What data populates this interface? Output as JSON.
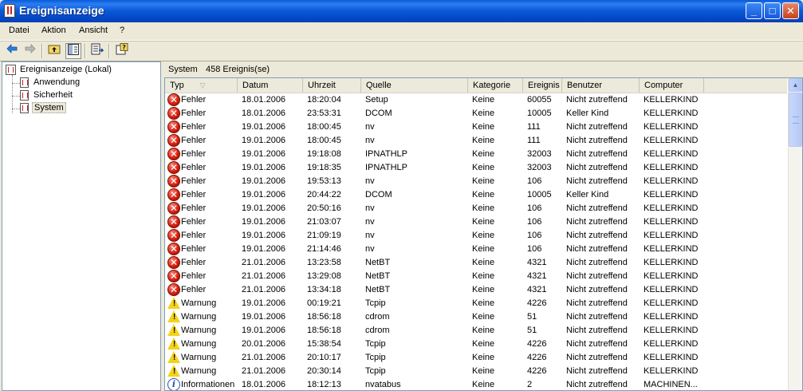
{
  "window": {
    "title": "Ereignisanzeige",
    "buttons": {
      "minimize": "_",
      "maximize": "□",
      "close": "✕"
    }
  },
  "menu": [
    {
      "label": "Datei"
    },
    {
      "label": "Aktion"
    },
    {
      "label": "Ansicht"
    },
    {
      "label": "?"
    }
  ],
  "toolbar": {
    "icons": [
      "back-arrow-icon",
      "forward-arrow-icon",
      "up-folder-icon",
      "show-hide-tree-icon",
      "export-list-icon",
      "help-icon"
    ],
    "active": "show-hide-tree-icon"
  },
  "tree": {
    "root": "Ereignisanzeige (Lokal)",
    "children": [
      {
        "label": "Anwendung"
      },
      {
        "label": "Sicherheit"
      },
      {
        "label": "System"
      }
    ],
    "selected": "System"
  },
  "status": {
    "log": "System",
    "count": "458 Ereignis(se)"
  },
  "columns": [
    "Typ",
    "Datum",
    "Uhrzeit",
    "Quelle",
    "Kategorie",
    "Ereignis",
    "Benutzer",
    "Computer"
  ],
  "events": [
    {
      "type": "error",
      "typ": "Fehler",
      "datum": "18.01.2006",
      "uhrzeit": "18:20:04",
      "quelle": "Setup",
      "kategorie": "Keine",
      "ereignis": "60055",
      "benutzer": "Nicht zutreffend",
      "computer": "KELLERKIND"
    },
    {
      "type": "error",
      "typ": "Fehler",
      "datum": "18.01.2006",
      "uhrzeit": "23:53:31",
      "quelle": "DCOM",
      "kategorie": "Keine",
      "ereignis": "10005",
      "benutzer": "Keller Kind",
      "computer": "KELLERKIND"
    },
    {
      "type": "error",
      "typ": "Fehler",
      "datum": "19.01.2006",
      "uhrzeit": "18:00:45",
      "quelle": "nv",
      "kategorie": "Keine",
      "ereignis": "111",
      "benutzer": "Nicht zutreffend",
      "computer": "KELLERKIND"
    },
    {
      "type": "error",
      "typ": "Fehler",
      "datum": "19.01.2006",
      "uhrzeit": "18:00:45",
      "quelle": "nv",
      "kategorie": "Keine",
      "ereignis": "111",
      "benutzer": "Nicht zutreffend",
      "computer": "KELLERKIND"
    },
    {
      "type": "error",
      "typ": "Fehler",
      "datum": "19.01.2006",
      "uhrzeit": "19:18:08",
      "quelle": "IPNATHLP",
      "kategorie": "Keine",
      "ereignis": "32003",
      "benutzer": "Nicht zutreffend",
      "computer": "KELLERKIND"
    },
    {
      "type": "error",
      "typ": "Fehler",
      "datum": "19.01.2006",
      "uhrzeit": "19:18:35",
      "quelle": "IPNATHLP",
      "kategorie": "Keine",
      "ereignis": "32003",
      "benutzer": "Nicht zutreffend",
      "computer": "KELLERKIND"
    },
    {
      "type": "error",
      "typ": "Fehler",
      "datum": "19.01.2006",
      "uhrzeit": "19:53:13",
      "quelle": "nv",
      "kategorie": "Keine",
      "ereignis": "106",
      "benutzer": "Nicht zutreffend",
      "computer": "KELLERKIND"
    },
    {
      "type": "error",
      "typ": "Fehler",
      "datum": "19.01.2006",
      "uhrzeit": "20:44:22",
      "quelle": "DCOM",
      "kategorie": "Keine",
      "ereignis": "10005",
      "benutzer": "Keller Kind",
      "computer": "KELLERKIND"
    },
    {
      "type": "error",
      "typ": "Fehler",
      "datum": "19.01.2006",
      "uhrzeit": "20:50:16",
      "quelle": "nv",
      "kategorie": "Keine",
      "ereignis": "106",
      "benutzer": "Nicht zutreffend",
      "computer": "KELLERKIND"
    },
    {
      "type": "error",
      "typ": "Fehler",
      "datum": "19.01.2006",
      "uhrzeit": "21:03:07",
      "quelle": "nv",
      "kategorie": "Keine",
      "ereignis": "106",
      "benutzer": "Nicht zutreffend",
      "computer": "KELLERKIND"
    },
    {
      "type": "error",
      "typ": "Fehler",
      "datum": "19.01.2006",
      "uhrzeit": "21:09:19",
      "quelle": "nv",
      "kategorie": "Keine",
      "ereignis": "106",
      "benutzer": "Nicht zutreffend",
      "computer": "KELLERKIND"
    },
    {
      "type": "error",
      "typ": "Fehler",
      "datum": "19.01.2006",
      "uhrzeit": "21:14:46",
      "quelle": "nv",
      "kategorie": "Keine",
      "ereignis": "106",
      "benutzer": "Nicht zutreffend",
      "computer": "KELLERKIND"
    },
    {
      "type": "error",
      "typ": "Fehler",
      "datum": "21.01.2006",
      "uhrzeit": "13:23:58",
      "quelle": "NetBT",
      "kategorie": "Keine",
      "ereignis": "4321",
      "benutzer": "Nicht zutreffend",
      "computer": "KELLERKIND"
    },
    {
      "type": "error",
      "typ": "Fehler",
      "datum": "21.01.2006",
      "uhrzeit": "13:29:08",
      "quelle": "NetBT",
      "kategorie": "Keine",
      "ereignis": "4321",
      "benutzer": "Nicht zutreffend",
      "computer": "KELLERKIND"
    },
    {
      "type": "error",
      "typ": "Fehler",
      "datum": "21.01.2006",
      "uhrzeit": "13:34:18",
      "quelle": "NetBT",
      "kategorie": "Keine",
      "ereignis": "4321",
      "benutzer": "Nicht zutreffend",
      "computer": "KELLERKIND"
    },
    {
      "type": "warning",
      "typ": "Warnung",
      "datum": "19.01.2006",
      "uhrzeit": "00:19:21",
      "quelle": "Tcpip",
      "kategorie": "Keine",
      "ereignis": "4226",
      "benutzer": "Nicht zutreffend",
      "computer": "KELLERKIND"
    },
    {
      "type": "warning",
      "typ": "Warnung",
      "datum": "19.01.2006",
      "uhrzeit": "18:56:18",
      "quelle": "cdrom",
      "kategorie": "Keine",
      "ereignis": "51",
      "benutzer": "Nicht zutreffend",
      "computer": "KELLERKIND"
    },
    {
      "type": "warning",
      "typ": "Warnung",
      "datum": "19.01.2006",
      "uhrzeit": "18:56:18",
      "quelle": "cdrom",
      "kategorie": "Keine",
      "ereignis": "51",
      "benutzer": "Nicht zutreffend",
      "computer": "KELLERKIND"
    },
    {
      "type": "warning",
      "typ": "Warnung",
      "datum": "20.01.2006",
      "uhrzeit": "15:38:54",
      "quelle": "Tcpip",
      "kategorie": "Keine",
      "ereignis": "4226",
      "benutzer": "Nicht zutreffend",
      "computer": "KELLERKIND"
    },
    {
      "type": "warning",
      "typ": "Warnung",
      "datum": "21.01.2006",
      "uhrzeit": "20:10:17",
      "quelle": "Tcpip",
      "kategorie": "Keine",
      "ereignis": "4226",
      "benutzer": "Nicht zutreffend",
      "computer": "KELLERKIND"
    },
    {
      "type": "warning",
      "typ": "Warnung",
      "datum": "21.01.2006",
      "uhrzeit": "20:30:14",
      "quelle": "Tcpip",
      "kategorie": "Keine",
      "ereignis": "4226",
      "benutzer": "Nicht zutreffend",
      "computer": "KELLERKIND"
    },
    {
      "type": "info",
      "typ": "Informationen",
      "datum": "18.01.2006",
      "uhrzeit": "18:12:13",
      "quelle": "nvatabus",
      "kategorie": "Keine",
      "ereignis": "2",
      "benutzer": "Nicht zutreffend",
      "computer": "MACHINEN..."
    }
  ],
  "colors": {
    "titlebar": "#0a58d6",
    "error": "#d01c0a",
    "warning": "#f3d21c",
    "info": "#2a4fb0"
  }
}
